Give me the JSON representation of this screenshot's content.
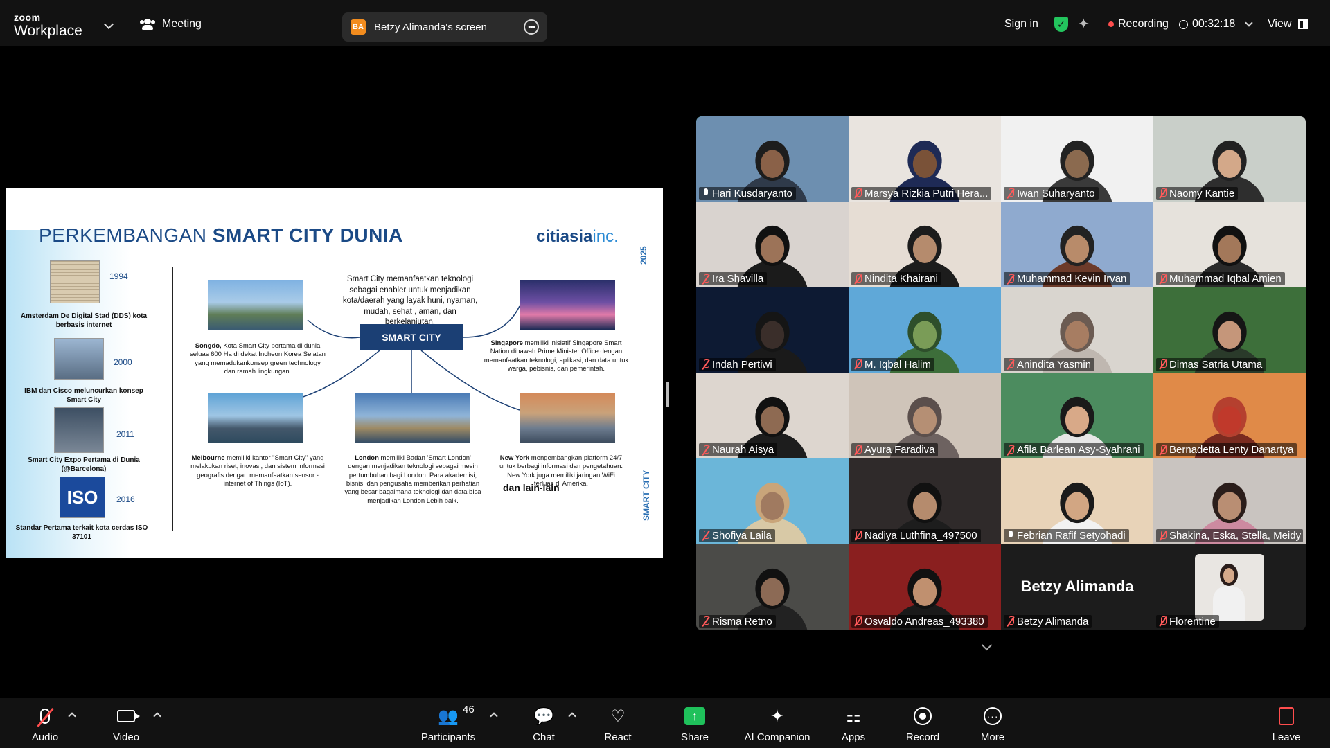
{
  "topbar": {
    "brand_small": "zoom",
    "brand_large": "Workplace",
    "meeting_label": "Meeting",
    "share_initials": "BA",
    "share_label": "Betzy Alimanda's screen",
    "sign_in": "Sign in",
    "recording_label": "Recording",
    "timer": "00:32:18",
    "view_label": "View",
    "colors": {
      "shield": "#23c55e",
      "recording_dot": "#ff4d4d",
      "share_badge": "#f28c1e"
    }
  },
  "slide": {
    "title_light": "PERKEMBANGAN ",
    "title_bold": "SMART CITY DUNIA",
    "logo_main": "citiasia",
    "logo_suffix": "inc.",
    "year_vertical": "2025",
    "vertical_label": "SMART CITY",
    "timeline": [
      {
        "year": "1994",
        "text": "Amsterdam De Digital Stad (DDS) kota berbasis internet",
        "image": "newspaper"
      },
      {
        "year": "2000",
        "text": "IBM dan Cisco meluncurkan konsep Smart City",
        "image": "ibm-building"
      },
      {
        "year": "2011",
        "text": "Smart City Expo Pertama di Dunia (@Barcelona)",
        "image": "expo-hall"
      },
      {
        "year": "2016",
        "text": "Standar Pertama terkait kota cerdas ISO 37101",
        "image": "iso-logo"
      }
    ],
    "iso_text": "ISO",
    "center_text": "Smart City memanfaatkan teknologi sebagai enabler untuk menjadikan kota/daerah yang layak huni, nyaman, mudah, sehat , aman, dan berkelanjutan.",
    "center_box": "SMART CITY",
    "cities": [
      {
        "name": "Songdo,",
        "text": " Kota Smart City pertama di dunia seluas 600 Ha di dekat Incheon Korea Selatan yang memadukankonsep green technology dan ramah lingkungan."
      },
      {
        "name": "Singapore",
        "text": " memiliki inisiatif Singapore Smart Nation dibawah Prime Minister Office dengan memanfaatkan teknologi, aplikasi, dan data untuk warga, pebisnis, dan pemerintah."
      },
      {
        "name": "Melbourne",
        "text": " memiliki kantor \"Smart City\" yang melakukan riset, inovasi, dan sistem informasi geografis dengan memanfaatkan sensor - internet of Things (IoT)."
      },
      {
        "name": "London",
        "text": " memiliki Badan 'Smart London' dengan menjadikan teknologi sebagai mesin pertumbuhan bagi London. Para akademisi, bisnis, dan pengusaha memberikan perhatian yang besar bagaimana teknologi dan data bisa menjadikan London Lebih baik."
      },
      {
        "name": "New York",
        "text": " mengembangkan platform 24/7 untuk berbagi informasi dan pengetahuan. New York juga memiliki jaringan WiFi terluas di Amerika."
      }
    ],
    "closing": "dan lain-lain"
  },
  "participants": [
    {
      "name": "Hari Kusdaryanto",
      "muted": false,
      "active": true,
      "bg": "#6d8fb0",
      "skin": "#8a6148",
      "shirt": "#2f3a4a",
      "head": "#1d1d1d"
    },
    {
      "name": "Marsya Rizkia Putri Hera...",
      "muted": true,
      "bg": "#e9e4df",
      "skin": "#7a5238",
      "shirt": "#1e2a55",
      "head": "#1e2a55"
    },
    {
      "name": "Iwan Suharyanto",
      "muted": true,
      "bg": "#f1f1f1",
      "skin": "#8b6a4f",
      "shirt": "#3a3a3a",
      "head": "#222"
    },
    {
      "name": "Naomy Kantie",
      "muted": true,
      "bg": "#c9cfc9",
      "skin": "#d3a889",
      "shirt": "#2e2e2e",
      "head": "#222"
    },
    {
      "name": "Ira Shavilla",
      "muted": true,
      "bg": "#d9d3cf",
      "skin": "#9c7358",
      "shirt": "#1b1b1b",
      "head": "#111"
    },
    {
      "name": "Nindita Khairani",
      "muted": true,
      "bg": "#e6ddd4",
      "skin": "#b58b6d",
      "shirt": "#1c1c1c",
      "head": "#1c1c1c"
    },
    {
      "name": "Muhammad Kevin Irvan",
      "muted": true,
      "bg": "#8faacf",
      "skin": "#b88b6a",
      "shirt": "#6d3b2a",
      "head": "#222"
    },
    {
      "name": "Muhammad Iqbal Amien",
      "muted": true,
      "bg": "#e6e2dc",
      "skin": "#a3785a",
      "shirt": "#2a2a2a",
      "head": "#111"
    },
    {
      "name": "Indah Pertiwi",
      "muted": true,
      "bg": "#0d1a33",
      "skin": "#3a2e2a",
      "shirt": "#1a1a1a",
      "head": "#151515"
    },
    {
      "name": "M. Iqbal Halim",
      "muted": true,
      "bg": "#5fa8d8",
      "skin": "#7a9c57",
      "shirt": "#3d6e3a",
      "head": "#2e4f2b"
    },
    {
      "name": "Anindita Yasmin",
      "muted": true,
      "bg": "#d9d5cf",
      "skin": "#a77d62",
      "shirt": "#bfb7b0",
      "head": "#6b5b52"
    },
    {
      "name": "Dimas Satria Utama",
      "muted": true,
      "bg": "#3d6f3a",
      "skin": "#c5967a",
      "shirt": "#2a3a2a",
      "head": "#151515"
    },
    {
      "name": "Naurah Aisya",
      "muted": true,
      "bg": "#ddd6cf",
      "skin": "#8e6a52",
      "shirt": "#1d1d1d",
      "head": "#111"
    },
    {
      "name": "Ayura Faradiva",
      "muted": true,
      "bg": "#cfc4b9",
      "skin": "#b58f74",
      "shirt": "#6d6260",
      "head": "#5b4f4c"
    },
    {
      "name": "Afila Barlean Asy-Syahrani",
      "muted": true,
      "bg": "#4c8c5f",
      "skin": "#d8a988",
      "shirt": "#e6e6e6",
      "head": "#1a1a1a"
    },
    {
      "name": "Bernadetta Lenty Danartya",
      "muted": true,
      "bg": "#e08a48",
      "skin": "#c0392b",
      "shirt": "#7a2b20",
      "head": "#b5402f"
    },
    {
      "name": "Shofiya Laila",
      "muted": true,
      "bg": "#6bb6d9",
      "skin": "#a07a60",
      "shirt": "#d8c9a6",
      "head": "#c9a57a"
    },
    {
      "name": "Nadiya Luthfina_497500",
      "muted": true,
      "bg": "#2f2a2a",
      "skin": "#b58b6d",
      "shirt": "#1d1d1d",
      "head": "#111"
    },
    {
      "name": "Febrian Rafif Setyohadi",
      "muted": false,
      "bg": "#e8d3b8",
      "skin": "#d2a683",
      "shirt": "#f2f2f2",
      "head": "#1a1a1a"
    },
    {
      "name": "Shakina, Eska, Stella, Meidy",
      "muted": true,
      "bg": "#c9c4c0",
      "skin": "#b98e73",
      "shirt": "#cc8aa0",
      "head": "#2a1d1a"
    },
    {
      "name": "Risma Retno",
      "muted": true,
      "bg": "#4b4b48",
      "skin": "#8c6a55",
      "shirt": "#222",
      "head": "#111"
    },
    {
      "name": "Osvaldo Andreas_493380",
      "muted": true,
      "bg": "#8a1f1f",
      "skin": "#c0906f",
      "shirt": "#1a1a1a",
      "head": "#111"
    },
    {
      "name": "Betzy Alimanda",
      "muted": true,
      "bg": "#1c1c1c",
      "big_name": "Betzy Alimanda",
      "no_video": true
    },
    {
      "name": "Florentine",
      "muted": true,
      "bg": "#1c1c1c",
      "thumb": true,
      "skin": "#d5a98a",
      "shirt": "#f1f1f1",
      "head": "#2a1d1a"
    }
  ],
  "bottombar": {
    "audio": "Audio",
    "video": "Video",
    "participants": "Participants",
    "participants_count": "46",
    "chat": "Chat",
    "react": "React",
    "share": "Share",
    "ai_companion": "AI Companion",
    "apps": "Apps",
    "record": "Record",
    "more": "More",
    "leave": "Leave",
    "colors": {
      "share": "#1fc15b",
      "leave": "#ff4d4d"
    }
  }
}
